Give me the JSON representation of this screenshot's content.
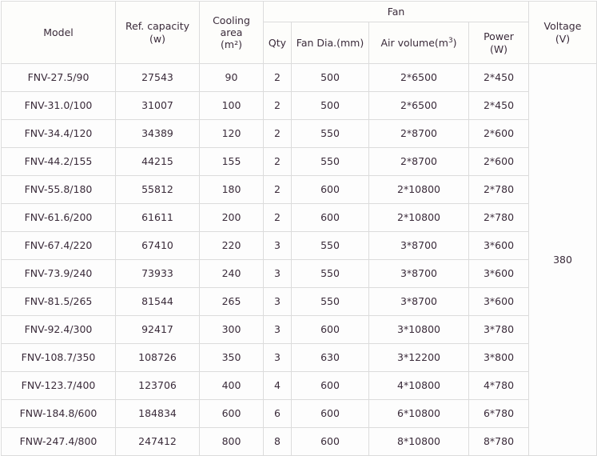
{
  "table": {
    "group_header": {
      "fan": "Fan"
    },
    "columns": {
      "model": {
        "label": "Model"
      },
      "ref_capacity": {
        "label": "Ref. capacity",
        "unit": "(w)"
      },
      "cooling_area": {
        "label": "Cooling",
        "label2": "area",
        "unit": "(m²)"
      },
      "qty": {
        "label": "Qty"
      },
      "fan_dia": {
        "label": "Fan Dia.(mm)"
      },
      "air_volume": {
        "label_pre": "Air volume(m",
        "label_sup": "3",
        "label_post": ")"
      },
      "power": {
        "label": "Power",
        "unit": "(W)"
      },
      "voltage": {
        "label": "Voltage",
        "unit": "(V)"
      }
    },
    "voltage_value": "380",
    "rows": [
      {
        "model": "FNV-27.5/90",
        "ref_capacity": "27543",
        "cooling_area": "90",
        "qty": "2",
        "fan_dia": "500",
        "air_volume": "2*6500",
        "power": "2*450"
      },
      {
        "model": "FNV-31.0/100",
        "ref_capacity": "31007",
        "cooling_area": "100",
        "qty": "2",
        "fan_dia": "500",
        "air_volume": "2*6500",
        "power": "2*450"
      },
      {
        "model": "FNV-34.4/120",
        "ref_capacity": "34389",
        "cooling_area": "120",
        "qty": "2",
        "fan_dia": "550",
        "air_volume": "2*8700",
        "power": "2*600"
      },
      {
        "model": "FNV-44.2/155",
        "ref_capacity": "44215",
        "cooling_area": "155",
        "qty": "2",
        "fan_dia": "550",
        "air_volume": "2*8700",
        "power": "2*600"
      },
      {
        "model": "FNV-55.8/180",
        "ref_capacity": "55812",
        "cooling_area": "180",
        "qty": "2",
        "fan_dia": "600",
        "air_volume": "2*10800",
        "power": "2*780"
      },
      {
        "model": "FNV-61.6/200",
        "ref_capacity": "61611",
        "cooling_area": "200",
        "qty": "2",
        "fan_dia": "600",
        "air_volume": "2*10800",
        "power": "2*780"
      },
      {
        "model": "FNV-67.4/220",
        "ref_capacity": "67410",
        "cooling_area": "220",
        "qty": "3",
        "fan_dia": "550",
        "air_volume": "3*8700",
        "power": "3*600"
      },
      {
        "model": "FNV-73.9/240",
        "ref_capacity": "73933",
        "cooling_area": "240",
        "qty": "3",
        "fan_dia": "550",
        "air_volume": "3*8700",
        "power": "3*600"
      },
      {
        "model": "FNV-81.5/265",
        "ref_capacity": "81544",
        "cooling_area": "265",
        "qty": "3",
        "fan_dia": "550",
        "air_volume": "3*8700",
        "power": "3*600"
      },
      {
        "model": "FNV-92.4/300",
        "ref_capacity": "92417",
        "cooling_area": "300",
        "qty": "3",
        "fan_dia": "600",
        "air_volume": "3*10800",
        "power": "3*780"
      },
      {
        "model": "FNV-108.7/350",
        "ref_capacity": "108726",
        "cooling_area": "350",
        "qty": "3",
        "fan_dia": "630",
        "air_volume": "3*12200",
        "power": "3*800"
      },
      {
        "model": "FNV-123.7/400",
        "ref_capacity": "123706",
        "cooling_area": "400",
        "qty": "4",
        "fan_dia": "600",
        "air_volume": "4*10800",
        "power": "4*780"
      },
      {
        "model": "FNW-184.8/600",
        "ref_capacity": "184834",
        "cooling_area": "600",
        "qty": "6",
        "fan_dia": "600",
        "air_volume": "6*10800",
        "power": "6*780"
      },
      {
        "model": "FNW-247.4/800",
        "ref_capacity": "247412",
        "cooling_area": "800",
        "qty": "8",
        "fan_dia": "600",
        "air_volume": "8*10800",
        "power": "8*780"
      }
    ]
  }
}
